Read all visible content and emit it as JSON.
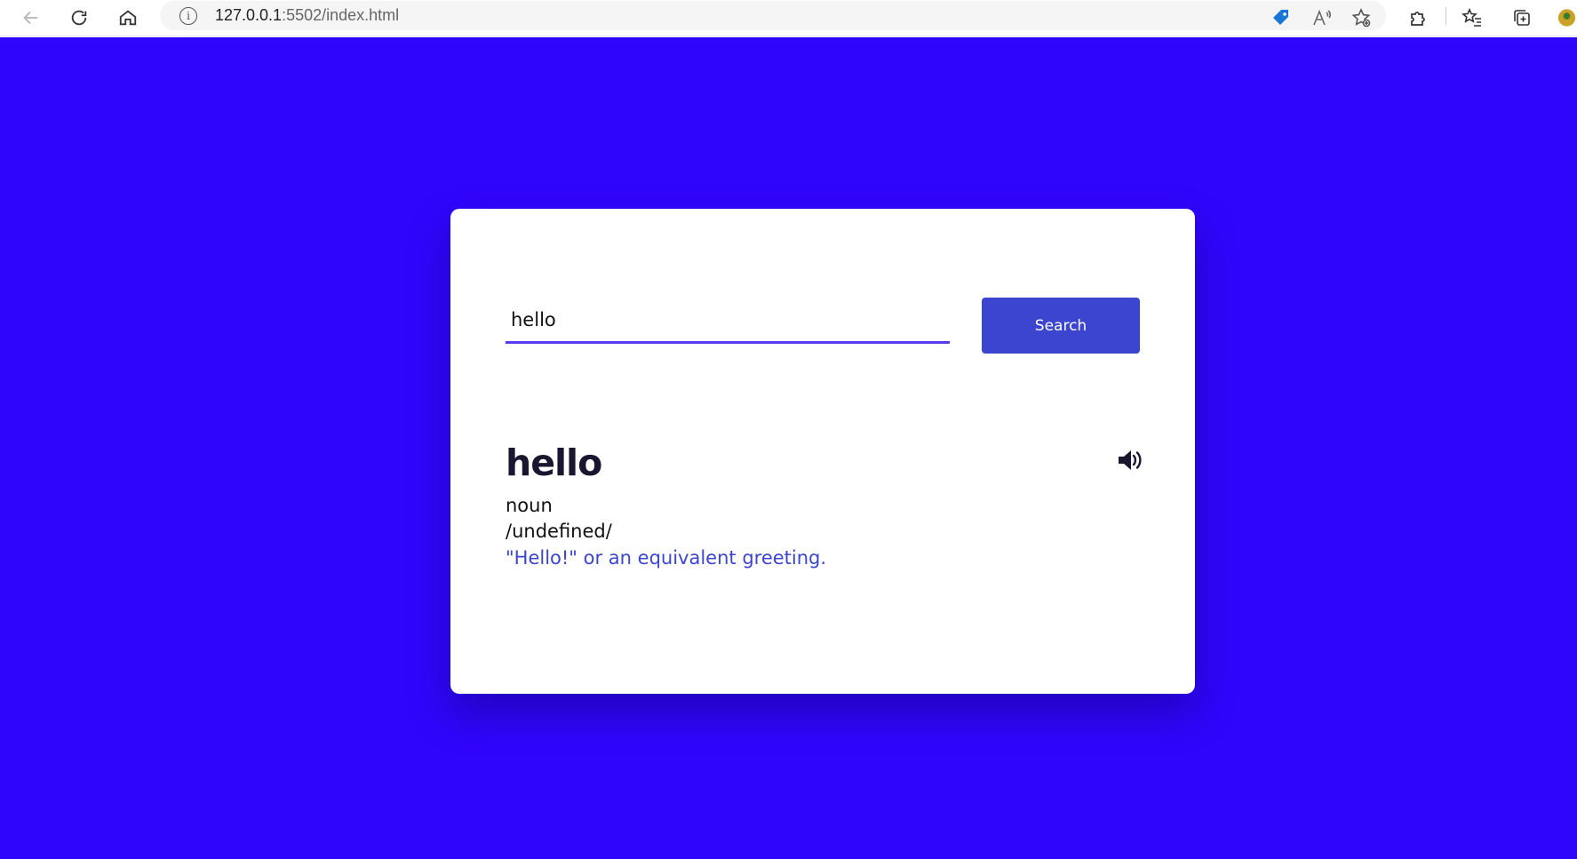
{
  "browser": {
    "url_host": "127.0.0.1",
    "url_rest": ":5502/index.html"
  },
  "search": {
    "value": "hello",
    "button_label": "Search"
  },
  "result": {
    "word": "hello",
    "part_of_speech": "noun",
    "phonetic": "/undefined/",
    "definition": "\"Hello!\" or an equivalent greeting."
  },
  "colors": {
    "page_background": "#3005fb",
    "accent": "#3c45cf",
    "input_underline": "#5a3cf0",
    "card": "#ffffff"
  },
  "icons": {
    "sound": "volume-up-icon"
  }
}
